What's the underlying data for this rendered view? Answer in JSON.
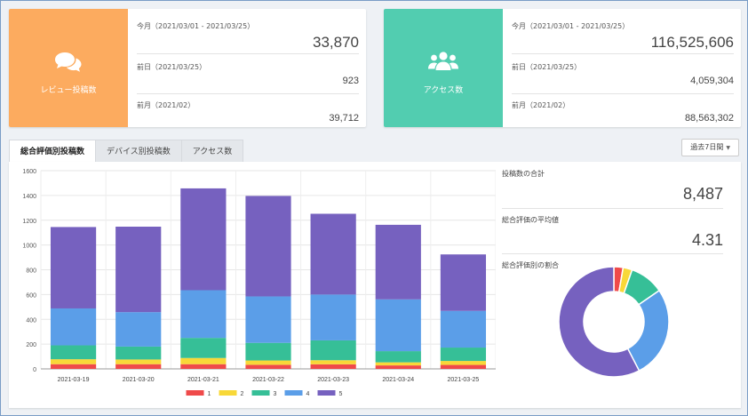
{
  "summary_cards": [
    {
      "icon": "comments-icon",
      "title": "レビュー投稿数",
      "color": "#fcab5f",
      "rows": [
        {
          "label": "今月（2021/03/01 - 2021/03/25）",
          "value": "33,870"
        },
        {
          "label": "前日（2021/03/25）",
          "value": "923"
        },
        {
          "label": "前月（2021/02）",
          "value": "39,712"
        }
      ]
    },
    {
      "icon": "users-icon",
      "title": "アクセス数",
      "color": "#52cdb0",
      "rows": [
        {
          "label": "今月（2021/03/01 - 2021/03/25）",
          "value": "116,525,606"
        },
        {
          "label": "前日（2021/03/25）",
          "value": "4,059,304"
        },
        {
          "label": "前月（2021/02）",
          "value": "88,563,302"
        }
      ]
    }
  ],
  "tabs": [
    {
      "label": "総合評価別投稿数",
      "active": true
    },
    {
      "label": "デバイス別投稿数",
      "active": false
    },
    {
      "label": "アクセス数",
      "active": false
    }
  ],
  "period_select": {
    "value": "過去7日間"
  },
  "side_panel": {
    "total_label": "投稿数の合計",
    "total_value": "8,487",
    "avg_label": "総合評価の平均値",
    "avg_value": "4.31",
    "ratio_label": "総合評価別の割合"
  },
  "colors": {
    "1": "#ef4a4a",
    "2": "#f8d838",
    "3": "#36bf97",
    "4": "#5b9ee8",
    "5": "#7661bf"
  },
  "chart_data": [
    {
      "type": "bar",
      "stacked": true,
      "categories": [
        "2021-03-19",
        "2021-03-20",
        "2021-03-21",
        "2021-03-22",
        "2021-03-23",
        "2021-03-24",
        "2021-03-25"
      ],
      "series": [
        {
          "name": "1",
          "values": [
            38,
            38,
            38,
            33,
            37,
            28,
            32
          ]
        },
        {
          "name": "2",
          "values": [
            40,
            38,
            50,
            35,
            33,
            25,
            32
          ]
        },
        {
          "name": "3",
          "values": [
            112,
            104,
            162,
            142,
            160,
            90,
            108
          ]
        },
        {
          "name": "4",
          "values": [
            298,
            278,
            385,
            375,
            370,
            418,
            296
          ]
        },
        {
          "name": "5",
          "values": [
            657,
            690,
            822,
            811,
            652,
            602,
            456
          ]
        }
      ],
      "ylim": [
        0,
        1600
      ],
      "yticks": [
        0,
        200,
        400,
        600,
        800,
        1000,
        1200,
        1400,
        1600
      ],
      "grid": true,
      "legend": "bottom"
    },
    {
      "type": "pie",
      "donut": true,
      "labels": [
        "1",
        "2",
        "3",
        "4",
        "5"
      ],
      "values": [
        2.7,
        2.7,
        10.0,
        27.0,
        57.6
      ]
    }
  ]
}
